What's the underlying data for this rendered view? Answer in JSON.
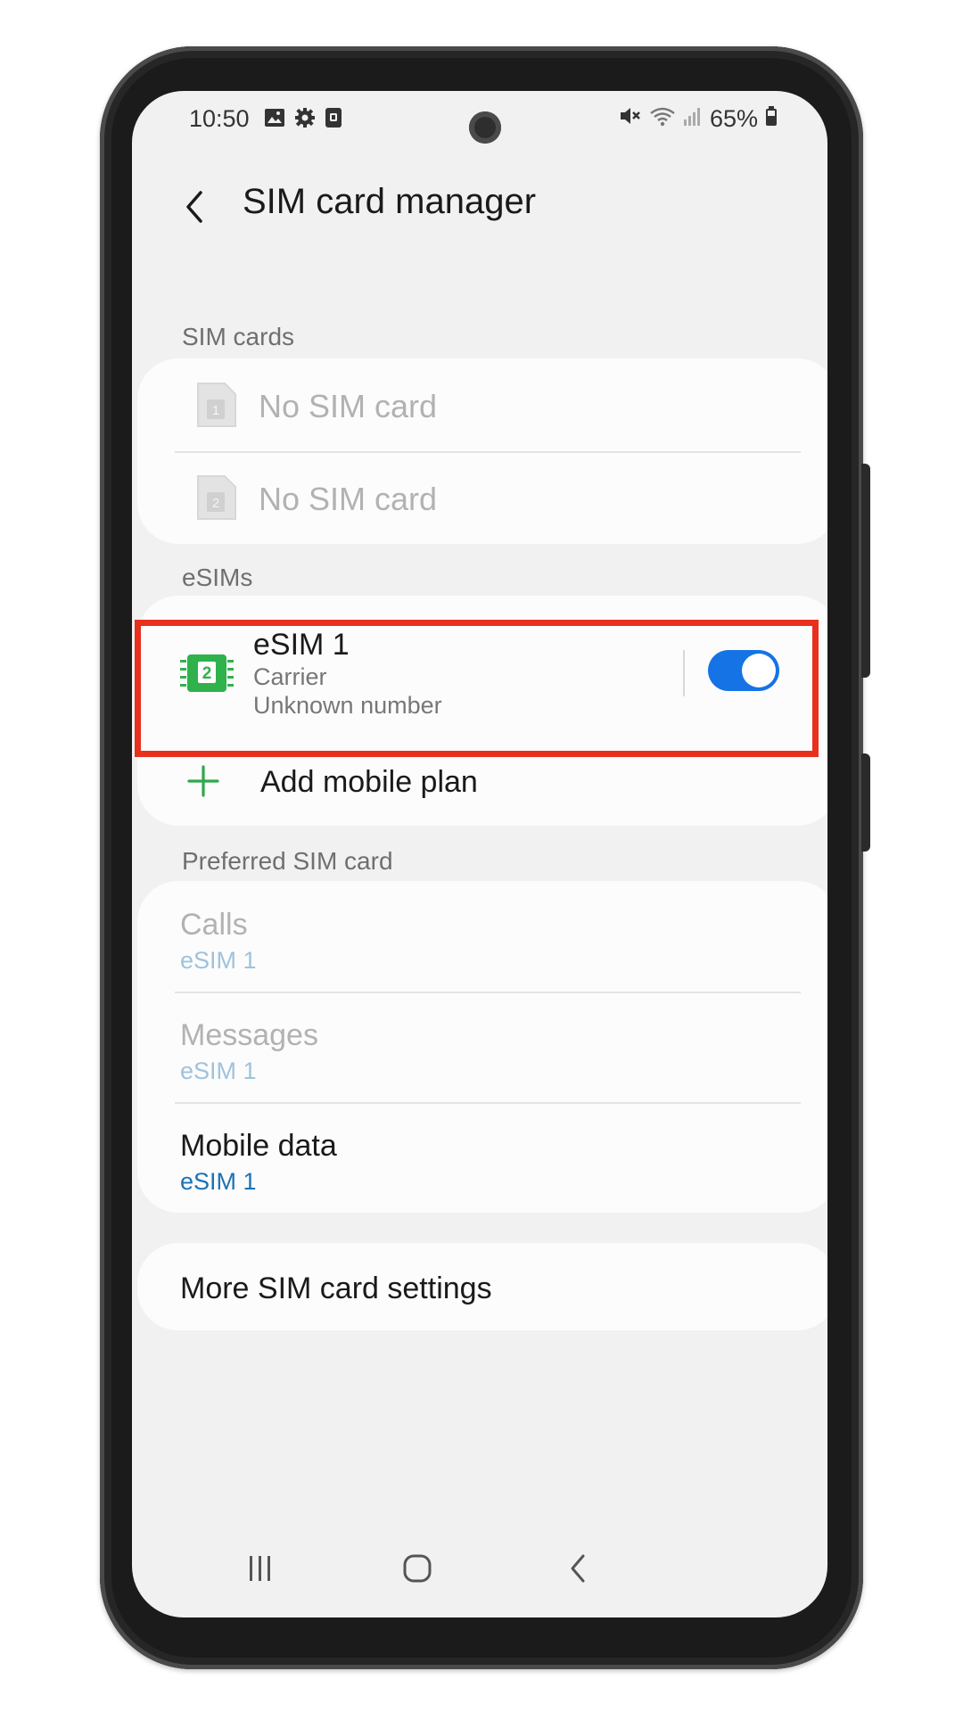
{
  "status_bar": {
    "time": "10:50",
    "battery": "65%",
    "icons_left": [
      "gallery-icon",
      "settings-gear-icon",
      "screenshot-icon"
    ],
    "icons_right": [
      "mute-icon",
      "wifi-icon",
      "signal-icon",
      "battery-icon"
    ]
  },
  "header": {
    "title": "SIM card manager",
    "back_icon": "chevron-left-icon"
  },
  "sim_cards": {
    "section_label": "SIM cards",
    "items": [
      {
        "label": "No SIM card",
        "slot": "1"
      },
      {
        "label": "No SIM card",
        "slot": "2"
      }
    ]
  },
  "esims": {
    "section_label": "eSIMs",
    "item": {
      "badge": "2",
      "name": "eSIM 1",
      "carrier": "Carrier",
      "number": "Unknown number",
      "enabled": true
    },
    "add_plan_label": "Add mobile plan"
  },
  "preferred": {
    "section_label": "Preferred SIM card",
    "items": [
      {
        "title": "Calls",
        "value": "eSIM 1"
      },
      {
        "title": "Messages",
        "value": "eSIM 1"
      },
      {
        "title": "Mobile data",
        "value": "eSIM 1"
      }
    ]
  },
  "more_settings": {
    "label": "More SIM card settings"
  },
  "nav_bar": {
    "icons": [
      "recent-apps-icon",
      "home-icon",
      "back-icon"
    ]
  },
  "colors": {
    "accent": "#1673e6",
    "highlight_border": "#e8301e",
    "esim_green": "#2fb24c",
    "link_blue": "#1a73b5"
  }
}
